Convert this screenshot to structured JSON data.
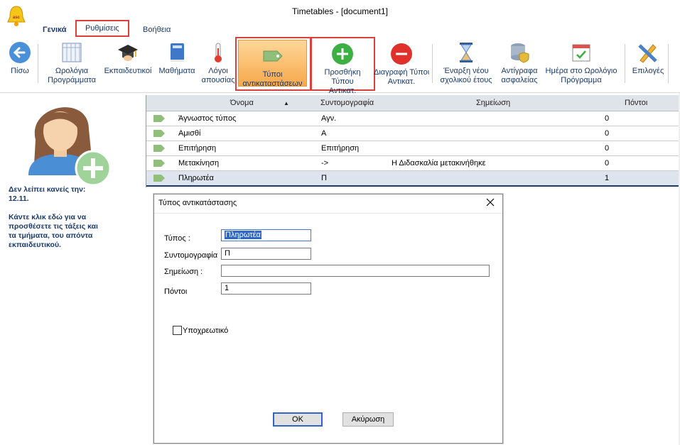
{
  "window": {
    "title": "Timetables - [document1]"
  },
  "menu": {
    "tabs": [
      {
        "label": "Γενικά"
      },
      {
        "label": "Ρυθμίσεις"
      },
      {
        "label": "Βοήθεια"
      }
    ]
  },
  "ribbon": {
    "back": "Πίσω",
    "timetables": [
      "Ωρολόγια",
      "Προγράμματα"
    ],
    "teachers": "Εκπαιδευτικοί",
    "subjects": "Μαθήματα",
    "absence_reasons": [
      "Λόγοι",
      "απουσίας"
    ],
    "sub_types": [
      "Τύποι",
      "αντικαταστάσεων"
    ],
    "add_type": [
      "Προσθήκη Τύπου",
      "Αντικατ."
    ],
    "delete_type": [
      "Διαγραφή Τύπου",
      "Αντικατ."
    ],
    "new_year": [
      "Έναρξη νέου",
      "σχολικού έτους"
    ],
    "backups": [
      "Αντίγραφα",
      "ασφαλείας"
    ],
    "day_in_timetable": [
      "Ημέρα στο Ωρολόγιο",
      "Πρόγραμμα"
    ],
    "options": "Επιλογές"
  },
  "left_panel": {
    "line1": "Δεν λείπει κανείς την:",
    "line2": "12.11.",
    "line3": "Κάντε κλικ εδώ για να",
    "line4": "προσθέσετε τις τάξεις και",
    "line5": "τα τμήματα, του απόντα",
    "line6": "εκπαιδευτικού."
  },
  "grid": {
    "headers": {
      "name": "Όνομα",
      "abbr": "Συντομογραφία",
      "note": "Σημείωση",
      "points": "Πόντοι"
    },
    "rows": [
      {
        "name": "Άγνωστος τύπος",
        "abbr": "Αγν.",
        "note": "",
        "points": "0"
      },
      {
        "name": "Αμισθί",
        "abbr": "Α",
        "note": "",
        "points": "0"
      },
      {
        "name": "Επιτήρηση",
        "abbr": "Επιτήρηση",
        "note": "",
        "points": "0"
      },
      {
        "name": "Μετακίνηση",
        "abbr": "->",
        "note": "Η Διδασκαλία μετακινήθηκε",
        "points": "0"
      },
      {
        "name": "Πληρωτέα",
        "abbr": "Π",
        "note": "",
        "points": "1"
      }
    ]
  },
  "dialog": {
    "title": "Τύπος αντικατάστασης",
    "type_label": "Τύπος :",
    "type_value": "Πληρωτέα",
    "abbr_label": "Συντομογραφία",
    "abbr_value": "Π",
    "note_label": "Σημείωση :",
    "note_value": "",
    "points_label": "Πόντοι",
    "points_value": "1",
    "mandatory_label": "Υποχρεωτικό",
    "ok": "OK",
    "cancel": "Ακύρωση"
  },
  "colors": {
    "accent": "#1b3a6b",
    "highlight_box": "#d9413a",
    "selected_text_bg": "#2f66c7"
  }
}
